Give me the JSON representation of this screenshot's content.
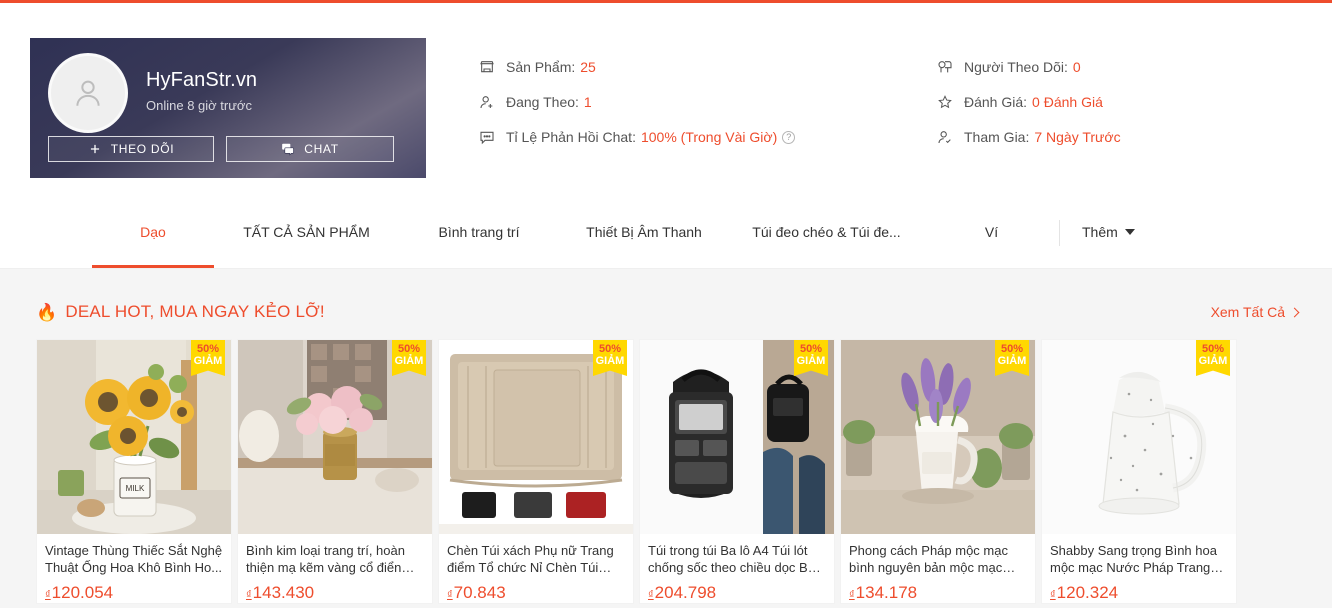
{
  "theme": {
    "accent": "#ee4d2d",
    "badge_bg": "#ffd800",
    "page_bg": "#f5f5f5"
  },
  "shop": {
    "name": "HyFanStr.vn",
    "online_status": "Online 8 giờ trước",
    "avatar_icon": "user-avatar-icon",
    "follow_button": "THEO DÕI",
    "chat_button": "CHAT"
  },
  "stats": {
    "left": [
      {
        "icon": "shop-icon",
        "label": "Sản Phẩm:",
        "value": "25",
        "help": false
      },
      {
        "icon": "person-add-icon",
        "label": "Đang Theo:",
        "value": "1",
        "help": false
      },
      {
        "icon": "chat-bubble-icon",
        "label": "Tỉ Lệ Phản Hồi Chat:",
        "value": "100% (Trong Vài Giờ)",
        "help": true,
        "help_glyph": "?"
      }
    ],
    "right": [
      {
        "icon": "followers-icon",
        "label": "Người Theo Dõi:",
        "value": "0",
        "help": false
      },
      {
        "icon": "star-icon",
        "label": "Đánh Giá:",
        "value": "0 Đánh Giá",
        "help": false
      },
      {
        "icon": "person-check-icon",
        "label": "Tham Gia:",
        "value": "7 Ngày Trước",
        "help": false
      }
    ]
  },
  "nav": {
    "tabs": [
      {
        "label": "Dạo",
        "active": true
      },
      {
        "label": "TẤT CẢ SẢN PHẨM",
        "active": false
      },
      {
        "label": "Bình trang trí",
        "active": false
      },
      {
        "label": "Thiết Bị Âm Thanh",
        "active": false
      },
      {
        "label": "Túi đeo chéo & Túi đe...",
        "active": false
      },
      {
        "label": "Ví",
        "active": false
      }
    ],
    "more_label": "Thêm",
    "more_icon": "chevron-down-icon"
  },
  "deal": {
    "flame_icon": "flame-icon",
    "title": "DEAL HOT, MUA NGAY KẺO LỠ!",
    "see_all": "Xem Tất Cả",
    "see_all_icon": "chevron-right-icon",
    "products": [
      {
        "name": "Vintage Thùng Thiếc Sắt Nghệ Thuật Ống Hoa Khô Bình Ho...",
        "price": "120.054",
        "currency": "₫",
        "discount_pct": "50%",
        "discount_label": "GIẢM",
        "image_alt": "sunflowers-in-white-milk-can"
      },
      {
        "name": "Bình kim loại trang trí, hoàn thiện mạ kẽm vàng cổ điển củ...",
        "price": "143.430",
        "currency": "₫",
        "discount_pct": "50%",
        "discount_label": "GIẢM",
        "image_alt": "pink-roses-in-gold-metal-vase"
      },
      {
        "name": "Chèn Túi xách Phụ nữ Trang điểm Tổ chức Nỉ Chèn Túi lót...",
        "price": "70.843",
        "currency": "₫",
        "discount_pct": "50%",
        "discount_label": "GIẢM",
        "image_alt": "beige-felt-bag-organizer-insert"
      },
      {
        "name": "Túi trong túi Ba lô A4 Túi lót chống sốc theo chiều dọc Ba ...",
        "price": "204.798",
        "currency": "₫",
        "discount_pct": "50%",
        "discount_label": "GIẢM",
        "image_alt": "black-backpack-organizer"
      },
      {
        "name": "Phong cách Pháp mộc mạc bình nguyên bản mộc mạc bì...",
        "price": "134.178",
        "currency": "₫",
        "discount_pct": "50%",
        "discount_label": "GIẢM",
        "image_alt": "lavender-in-white-rustic-pitcher"
      },
      {
        "name": "Shabby Sang trọng Bình hoa mộc mạc Nước Pháp Trang tr...",
        "price": "120.324",
        "currency": "₫",
        "discount_pct": "50%",
        "discount_label": "GIẢM",
        "image_alt": "white-distressed-metal-pitcher"
      }
    ]
  }
}
